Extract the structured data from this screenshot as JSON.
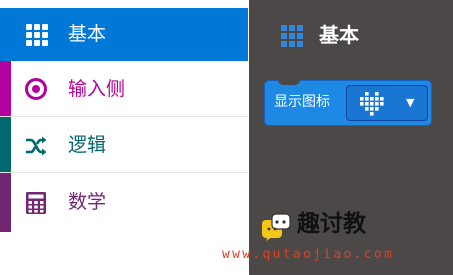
{
  "toolbox": {
    "categories": [
      {
        "label": "基本",
        "icon": "grid-icon",
        "color": "#0078d7",
        "selected": true
      },
      {
        "label": "输入侧",
        "icon": "target-icon",
        "color": "#b4009e",
        "selected": false
      },
      {
        "label": "逻辑",
        "icon": "shuffle-icon",
        "color": "#006970",
        "selected": false
      },
      {
        "label": "数学",
        "icon": "calculator-icon",
        "color": "#712672",
        "selected": false
      }
    ]
  },
  "workspace": {
    "title": "基本",
    "title_icon": "grid-icon",
    "block": {
      "label": "显示图标",
      "value_icon": "heart-icon",
      "dropdown_icon": "caret-down-icon",
      "color": "#1e88e5"
    }
  },
  "watermark": {
    "brand": "趣讨教",
    "url": "www.qutaojiao.com"
  }
}
